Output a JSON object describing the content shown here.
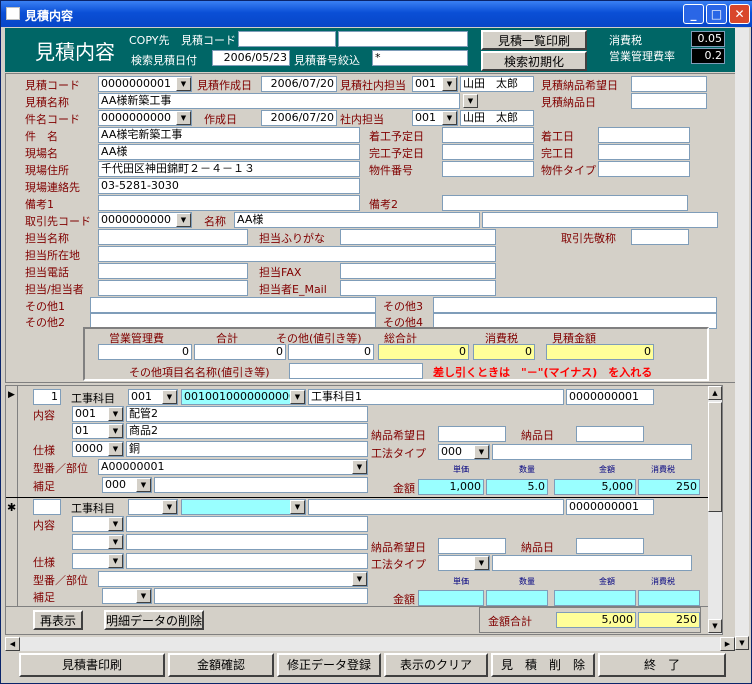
{
  "window": {
    "title": "見積内容"
  },
  "header": {
    "title": "見積内容",
    "copy_label": "COPY先",
    "copy_code_label": "見積コード",
    "search_date_label": "検索見積日付",
    "search_date": "2006/05/23",
    "search_no_label": "見積番号絞込",
    "search_no": "*",
    "print_list_btn": "見積一覧印刷",
    "reset_btn": "検索初期化",
    "tax_label": "消費税",
    "tax_value": "0.05",
    "mgmt_label": "営業管理費率",
    "mgmt_value": "0.2"
  },
  "form": {
    "estimate_code_label": "見積コード",
    "estimate_code": "0000000001",
    "created_date_label": "見積作成日",
    "created_date": "2006/07/20",
    "internal_staff_label": "見積社内担当",
    "internal_staff_code": "001",
    "internal_staff_name": "山田　太郎",
    "delivery_wish_label": "見積納品希望日",
    "delivery_label": "見積納品日",
    "estimate_name_label": "見積名称",
    "estimate_name": "AA様新築工事",
    "item_code_label": "件名コード",
    "item_code": "0000000000",
    "create_date2_label": "作成日",
    "create_date2": "2006/07/20",
    "staff2_label": "社内担当",
    "staff2_code": "001",
    "staff2_name": "山田　太郎",
    "item_name_label": "件　名",
    "item_name": "AA様宅新築工事",
    "start_plan_label": "着工予定日",
    "start_label": "着工日",
    "site_name_label": "現場名",
    "site_name": "AA様",
    "finish_plan_label": "完工予定日",
    "finish_label": "完工日",
    "site_addr_label": "現場住所",
    "site_addr": "千代田区神田錦町２－４－１３",
    "property_no_label": "物件番号",
    "property_type_label": "物件タイプ",
    "site_tel_label": "現場連絡先",
    "site_tel": "03-5281-3030",
    "note1_label": "備考1",
    "note2_label": "備考2",
    "client_code_label": "取引先コード",
    "client_code": "0000000000",
    "client_name_label": "名称",
    "client_name": "AA様",
    "person_name_label": "担当名称",
    "person_kana_label": "担当ふりがな",
    "client_honor_label": "取引先敬称",
    "person_addr_label": "担当所在地",
    "person_tel_label": "担当電話",
    "person_fax_label": "担当FAX",
    "person_staff_label": "担当/担当者",
    "person_mail_label": "担当者E_Mail",
    "other1_label": "その他1",
    "other2_label": "その他2",
    "other3_label": "その他3",
    "other4_label": "その他4"
  },
  "summary": {
    "mgmt_cost_label": "営業管理費",
    "total_label": "合計",
    "other_label": "その他(値引き等)",
    "grand_total_label": "総合計",
    "tax_label": "消費税",
    "est_amount_label": "見積金額",
    "mgmt_cost": "0",
    "total": "0",
    "other": "0",
    "grand_total": "0",
    "tax": "0",
    "est_amount": "0",
    "other_name_label": "その他項目名名称(値引き等)",
    "notice": "差し引くときは　\"－\"(マイナス)　を入れる"
  },
  "detail": {
    "rows": [
      {
        "marker": "▶",
        "row_no": "1",
        "work_label": "工事科目",
        "work_code": "001",
        "work_full": "0010010000000000",
        "work_name": "工事科目1",
        "right_code": "0000000001",
        "content_label": "内容",
        "content_code": "001",
        "content_name": "配管2",
        "sub_code": "01",
        "sub_name": "商品2",
        "wish_label": "納品希望日",
        "deliv_label": "納品日",
        "spec_label": "仕様",
        "spec_code": "0000",
        "spec_name": "銅",
        "method_label": "工法タイプ",
        "method_code": "000",
        "model_label": "型番／部位",
        "model_value": "A00000001",
        "unit_label": "単価",
        "qty_label": "数量",
        "amt_label": "金額",
        "tax_label": "消費税",
        "supp_label": "補足",
        "supp_code": "000",
        "amount_label": "金額",
        "unit_price": "1,000",
        "qty": "5.0",
        "amount": "5,000",
        "tax": "250"
      },
      {
        "marker": "✱",
        "row_no": "",
        "work_label": "工事科目",
        "work_code": "",
        "work_full": "",
        "work_name": "",
        "right_code": "0000000001",
        "content_label": "内容",
        "content_code": "",
        "content_name": "",
        "sub_code": "",
        "sub_name": "",
        "wish_label": "納品希望日",
        "deliv_label": "納品日",
        "spec_label": "仕様",
        "spec_code": "",
        "spec_name": "",
        "method_label": "工法タイプ",
        "method_code": "",
        "model_label": "型番／部位",
        "model_value": "",
        "unit_label": "単価",
        "qty_label": "数量",
        "amt_label": "金額",
        "tax_label": "消費税",
        "supp_label": "補足",
        "supp_code": "",
        "amount_label": "金額",
        "unit_price": "",
        "qty": "",
        "amount": "",
        "tax": ""
      }
    ],
    "redisplay_btn": "再表示",
    "delete_detail_btn": "明細データの削除",
    "total_label": "金額合計",
    "total_amount": "5,000",
    "total_tax": "250"
  },
  "footer": {
    "buttons": [
      "見積書印刷",
      "金額確認",
      "修正データ登録",
      "表示のクリア",
      "見　積　削　除",
      "終　了"
    ]
  }
}
